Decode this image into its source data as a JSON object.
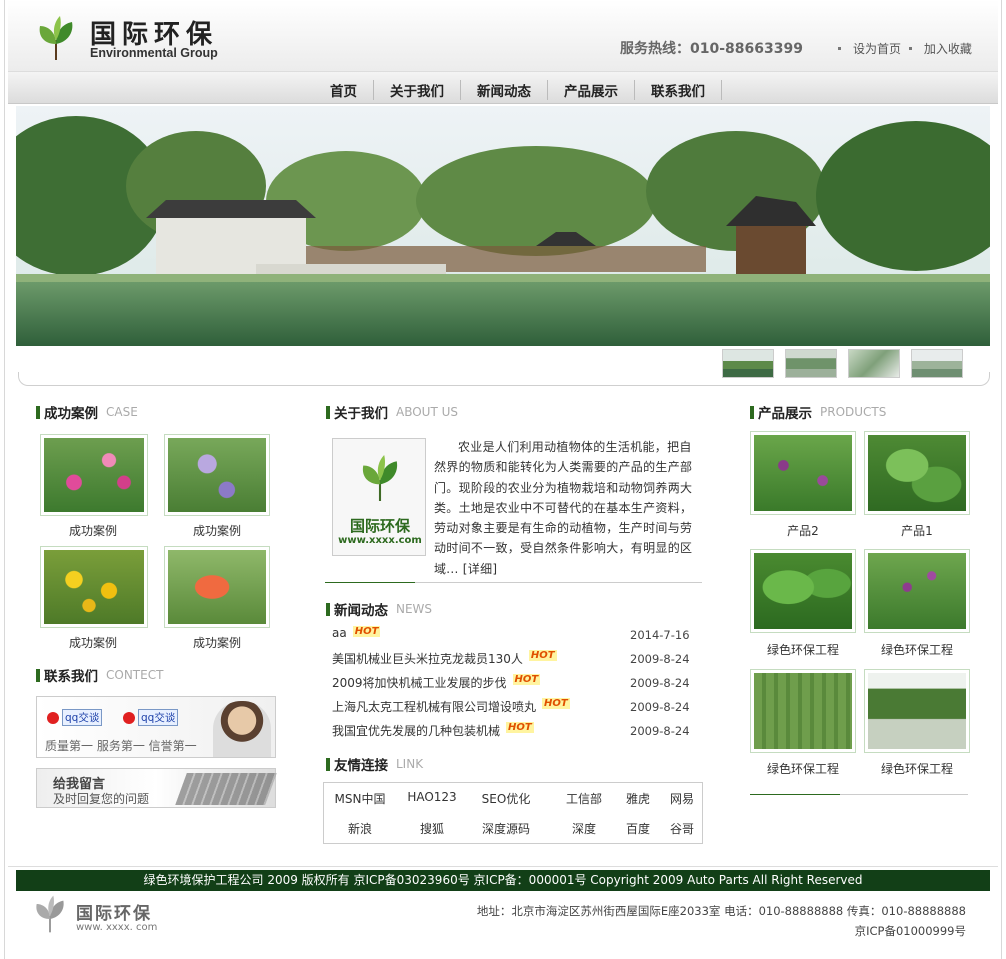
{
  "header": {
    "brand_cn": "国际环保",
    "brand_en": "Environmental Group",
    "hotline": "服务热线：010-88663399",
    "set_home": "设为首页",
    "add_fav": "加入收藏"
  },
  "nav": [
    "首页",
    "关于我们",
    "新闻动态",
    "产品展示",
    "联系我们"
  ],
  "cases": {
    "title": "成功案例",
    "title_en": "CASE",
    "items": [
      "成功案例",
      "成功案例",
      "成功案例",
      "成功案例"
    ]
  },
  "contact": {
    "title": "联系我们",
    "title_en": "CONTECT",
    "qq1": "qq交谈",
    "qq2": "qq交谈",
    "slogan": "质量第一  服务第一  信誉第一",
    "msg_title": "给我留言",
    "msg_sub": "及时回复您的问题"
  },
  "about": {
    "title": "关于我们",
    "title_en": "ABOUT US",
    "logo_cn": "国际环保",
    "logo_url": "www.xxxx.com",
    "text": "农业是人们利用动植物体的生活机能，把自然界的物质和能转化为人类需要的产品的生产部门。现阶段的农业分为植物栽培和动物饲养两大类。土地是农业中不可替代的在基本生产资料，劳动对象主要是有生命的动植物，生产时间与劳动时间不一致，受自然条件影响大，有明显的区域...",
    "more": "[详细]"
  },
  "news": {
    "title": "新闻动态",
    "title_en": "NEWS",
    "hot_label": "HOT",
    "items": [
      {
        "title": "aa",
        "date": "2014-7-16"
      },
      {
        "title": "美国机械业巨头米拉克龙裁员130人",
        "date": "2009-8-24"
      },
      {
        "title": "2009将加快机械工业发展的步伐",
        "date": "2009-8-24"
      },
      {
        "title": "上海凡太克工程机械有限公司增设喷丸",
        "date": "2009-8-24"
      },
      {
        "title": "我国宜优先发展的几种包装机械",
        "date": "2009-8-24"
      }
    ]
  },
  "links": {
    "title": "友情连接",
    "title_en": "LINK",
    "row1": [
      "MSN中国",
      "HAO123",
      "SEO优化",
      "工信部",
      "雅虎",
      "网易"
    ],
    "row2": [
      "新浪",
      "搜狐",
      "深度源码",
      "深度",
      "百度",
      "谷哥"
    ]
  },
  "products": {
    "title": "产品展示",
    "title_en": "PRODUCTS",
    "items": [
      "产品2",
      "产品1",
      "绿色环保工程",
      "绿色环保工程",
      "绿色环保工程",
      "绿色环保工程"
    ]
  },
  "footer": {
    "copyright": "绿色环境保护工程公司 2009 版权所有 京ICP备03023960号 京ICP备：000001号 Copyright 2009 Auto Parts All Right Reserved",
    "logo_cn": "国际环保",
    "logo_en": "www. xxxx. com",
    "address": "地址：北京市海淀区苏州街西屋国际E座2033室  电话：010-88888888  传真：010-88888888",
    "icp": "京ICP备01000999号"
  },
  "colors": {
    "accent": "#2d6a1f",
    "footer_bar": "#123f17",
    "hot": "#e05000"
  }
}
